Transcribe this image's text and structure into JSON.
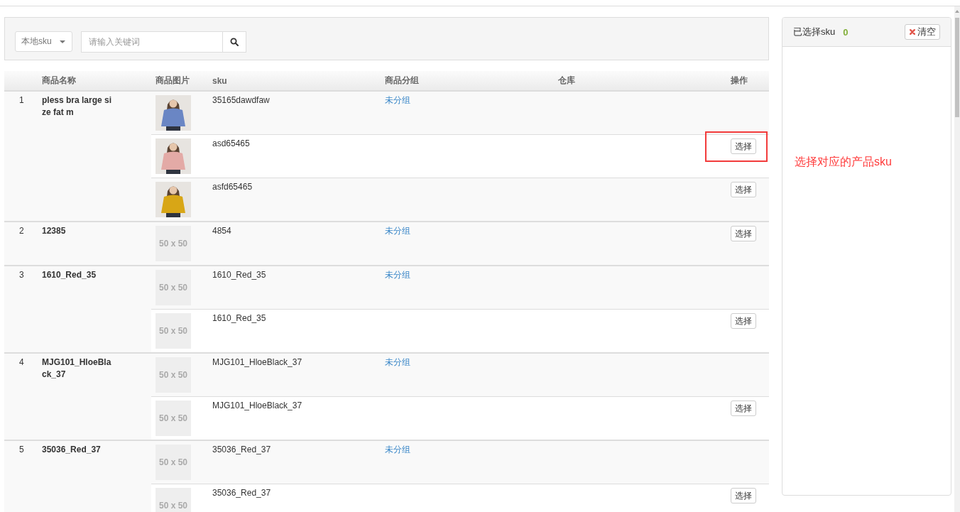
{
  "search_bar": {
    "scope_dropdown": {
      "value": "本地sku"
    },
    "keyword_field": {
      "placeholder": "请输入关键词"
    }
  },
  "table": {
    "columns": [
      "商品名称",
      "商品图片",
      "sku",
      "商品分组",
      "仓库",
      "操作"
    ],
    "rows": [
      {
        "index": "1",
        "name": "pless bra large size fat m",
        "variants": [
          {
            "image": {
              "kind": "photo",
              "color": "#6a86c4"
            },
            "sku": "35165dawdfaw",
            "group": "未分组",
            "annotated": false
          },
          {
            "image": {
              "kind": "photo",
              "color": "#e3aaa6"
            },
            "sku": "asd65465",
            "action": "选择",
            "annotated": true
          },
          {
            "image": {
              "kind": "photo",
              "color": "#d8a616"
            },
            "sku": "asfd65465",
            "action": "选择",
            "annotated": false
          }
        ]
      },
      {
        "index": "2",
        "name": "12385",
        "variants": [
          {
            "image": {
              "kind": "placeholder",
              "text": "50 x 50"
            },
            "sku": "4854",
            "group": "未分组",
            "action": "选择",
            "annotated": false
          }
        ]
      },
      {
        "index": "3",
        "name": "1610_Red_35",
        "variants": [
          {
            "image": {
              "kind": "placeholder",
              "text": "50 x 50"
            },
            "sku": "1610_Red_35",
            "group": "未分组",
            "annotated": false
          },
          {
            "image": {
              "kind": "placeholder",
              "text": "50 x 50"
            },
            "sku": "1610_Red_35",
            "action": "选择",
            "annotated": false
          }
        ]
      },
      {
        "index": "4",
        "name": "MJG101_HloeBlack_37",
        "variants": [
          {
            "image": {
              "kind": "placeholder",
              "text": "50 x 50"
            },
            "sku": "MJG101_HloeBlack_37",
            "group": "未分组",
            "annotated": false
          },
          {
            "image": {
              "kind": "placeholder",
              "text": "50 x 50"
            },
            "sku": "MJG101_HloeBlack_37",
            "action": "选择",
            "annotated": false
          }
        ]
      },
      {
        "index": "5",
        "name": "35036_Red_37",
        "variants": [
          {
            "image": {
              "kind": "placeholder",
              "text": "50 x 50"
            },
            "sku": "35036_Red_37",
            "group": "未分组",
            "annotated": false
          },
          {
            "image": {
              "kind": "placeholder",
              "text": "50 x 50"
            },
            "sku": "35036_Red_37",
            "action": "选择",
            "annotated": false
          }
        ]
      }
    ]
  },
  "selected_panel": {
    "title": "已选择sku",
    "count": "0",
    "clear_button": "清空",
    "note": "选择对应的产品sku"
  }
}
